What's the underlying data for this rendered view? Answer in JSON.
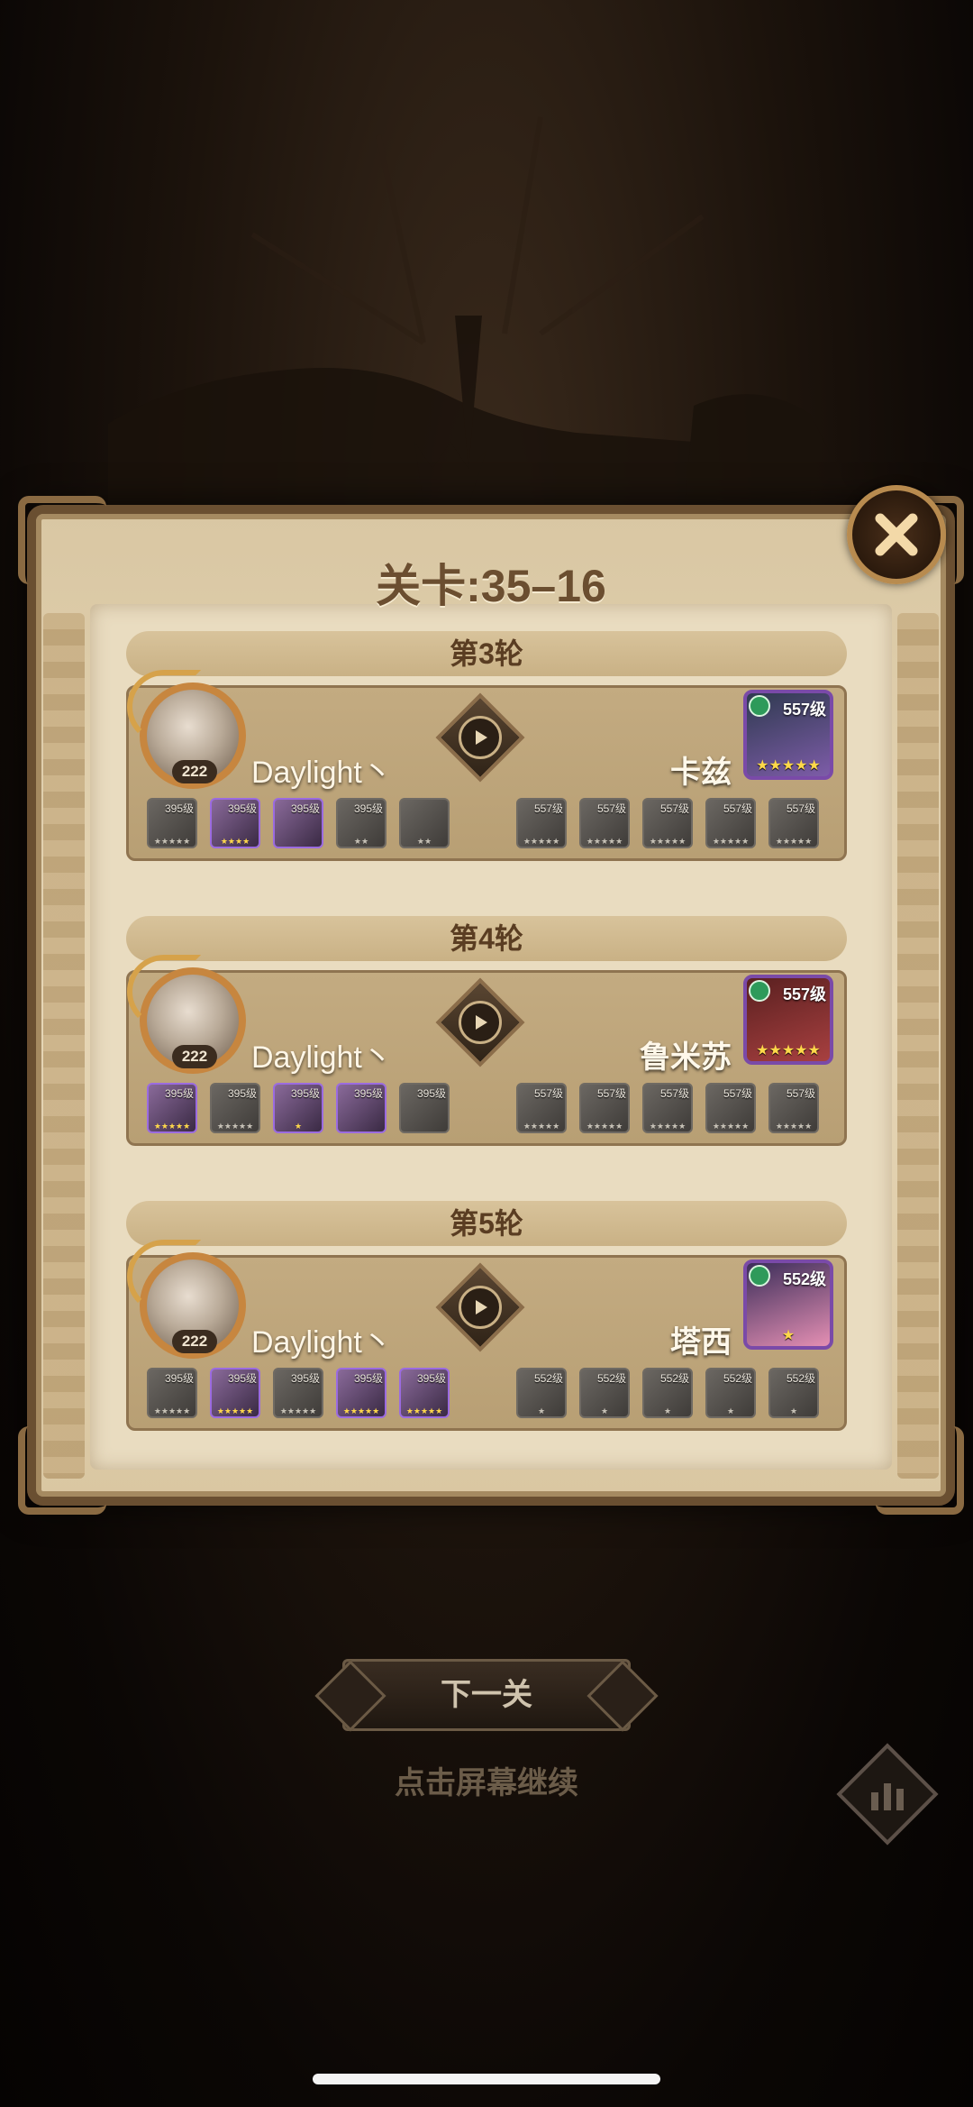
{
  "panel": {
    "title": "关卡:35–16",
    "close_label": "×"
  },
  "rounds": [
    {
      "label": "第3轮",
      "player": {
        "level": "222",
        "name": "Daylight丶"
      },
      "boss": {
        "name": "卡兹",
        "level": "557级",
        "stars": "★★★★★"
      },
      "player_slots": [
        {
          "level": "395级",
          "stars": "★★★★★",
          "active": false
        },
        {
          "level": "395级",
          "stars": "★★★★",
          "active": true
        },
        {
          "level": "395级",
          "stars": "",
          "active": true
        },
        {
          "level": "395级",
          "stars": "★★",
          "active": false
        },
        {
          "level": "",
          "stars": "★★",
          "active": false
        }
      ],
      "enemy_slots": [
        {
          "level": "557级",
          "stars": "★★★★★"
        },
        {
          "level": "557级",
          "stars": "★★★★★"
        },
        {
          "level": "557级",
          "stars": "★★★★★"
        },
        {
          "level": "557级",
          "stars": "★★★★★"
        },
        {
          "level": "557级",
          "stars": "★★★★★"
        }
      ]
    },
    {
      "label": "第4轮",
      "player": {
        "level": "222",
        "name": "Daylight丶"
      },
      "boss": {
        "name": "鲁米苏",
        "level": "557级",
        "stars": "★★★★★"
      },
      "player_slots": [
        {
          "level": "395级",
          "stars": "★★★★★",
          "active": true
        },
        {
          "level": "395级",
          "stars": "★★★★★",
          "active": false
        },
        {
          "level": "395级",
          "stars": "★",
          "active": true
        },
        {
          "level": "395级",
          "stars": "",
          "active": true
        },
        {
          "level": "395级",
          "stars": "",
          "active": false
        }
      ],
      "enemy_slots": [
        {
          "level": "557级",
          "stars": "★★★★★"
        },
        {
          "level": "557级",
          "stars": "★★★★★"
        },
        {
          "level": "557级",
          "stars": "★★★★★"
        },
        {
          "level": "557级",
          "stars": "★★★★★"
        },
        {
          "level": "557级",
          "stars": "★★★★★"
        }
      ]
    },
    {
      "label": "第5轮",
      "player": {
        "level": "222",
        "name": "Daylight丶"
      },
      "boss": {
        "name": "塔西",
        "level": "552级",
        "stars": "★"
      },
      "player_slots": [
        {
          "level": "395级",
          "stars": "★★★★★",
          "active": false
        },
        {
          "level": "395级",
          "stars": "★★★★★",
          "active": true
        },
        {
          "level": "395级",
          "stars": "★★★★★",
          "active": false
        },
        {
          "level": "395级",
          "stars": "★★★★★",
          "active": true
        },
        {
          "level": "395级",
          "stars": "★★★★★",
          "active": true
        }
      ],
      "enemy_slots": [
        {
          "level": "552级",
          "stars": "★"
        },
        {
          "level": "552级",
          "stars": "★"
        },
        {
          "level": "552级",
          "stars": "★"
        },
        {
          "level": "552级",
          "stars": "★"
        },
        {
          "level": "552级",
          "stars": "★"
        }
      ]
    }
  ],
  "footer": {
    "next_label": "下一关",
    "hint": "点击屏幕继续"
  },
  "colors": {
    "panel": "#e9dcc0",
    "accent": "#c7863f",
    "purple_frame": "#7a4aa8"
  }
}
